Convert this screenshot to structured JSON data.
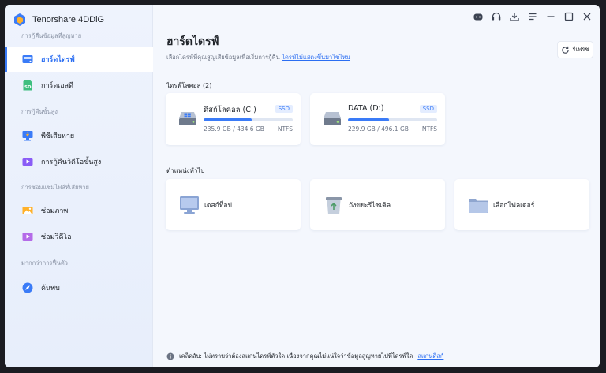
{
  "app": {
    "name": "Tenorshare 4DDiG"
  },
  "sidebar": {
    "sections": [
      {
        "title": "การกู้คืนข้อมูลที่สูญหาย"
      },
      {
        "title": "การกู้คืนขั้นสูง"
      },
      {
        "title": "การซ่อมแซมไฟล์ที่เสียหาย"
      },
      {
        "title": "มากกว่าการฟื้นตัว"
      }
    ],
    "items": [
      {
        "label": "ฮาร์ดไดรฟ์",
        "icon": "hard-drive-icon",
        "active": true
      },
      {
        "label": "การ์ดเอสดี",
        "icon": "sd-card-icon"
      },
      {
        "label": "พีซีเสียหาย",
        "icon": "crashed-pc-icon"
      },
      {
        "label": "การกู้คืนวิดีโอขั้นสูง",
        "icon": "video-recovery-icon"
      },
      {
        "label": "ซ่อมภาพ",
        "icon": "photo-repair-icon"
      },
      {
        "label": "ซ่อมวิดีโอ",
        "icon": "video-repair-icon"
      },
      {
        "label": "ค้นพบ",
        "icon": "compass-icon"
      }
    ]
  },
  "controls": [
    "robot-icon",
    "headset-icon",
    "download-icon",
    "menu-icon",
    "minimize-icon",
    "maximize-icon",
    "close-icon"
  ],
  "main": {
    "title": "ฮาร์ดไดรฟ์",
    "subtitle": "เลือกไดรฟ์ที่คุณสูญเสียข้อมูลเพื่อเริ่มการกู้คืน",
    "subtitle_link": "ไดรฟ์ไม่แสดงขึ้นมาใช่ไหม",
    "refresh_label": "รีเฟรช",
    "local_disks_title": "ไดรฟ์โลคอล (2)",
    "drives": [
      {
        "name": "ดิสก์โลคอล (C:)",
        "tag": "SSD",
        "size": "235.9 GB / 434.6 GB",
        "fs": "NTFS",
        "used_fraction": 0.543
      },
      {
        "name": "DATA (D:)",
        "tag": "SSD",
        "size": "229.9 GB / 496.1 GB",
        "fs": "NTFS",
        "used_fraction": 0.463
      }
    ],
    "common_locations_title": "ตำแหน่งทั่วไป",
    "locations": [
      {
        "label": "เดสก์ท็อป",
        "icon": "desktop-icon"
      },
      {
        "label": "ถังขยะรีไซเคิล",
        "icon": "recycle-bin-icon"
      },
      {
        "label": "เลือกโฟลเดอร์",
        "icon": "folder-icon"
      }
    ],
    "tip_text": "เคล็ดลับ: ไม่ทราบว่าต้องสแกนไดรฟ์ตัวใด เนื่องจากคุณไม่แน่ใจว่าข้อมูลสูญหายไปที่ไดรฟ์ใด",
    "tip_link": "สแกนดิสก์"
  },
  "colors": {
    "accent": "#3a7bf7",
    "sidebar_bg": "#eaf0fc",
    "content_bg": "#f4f7fd"
  }
}
